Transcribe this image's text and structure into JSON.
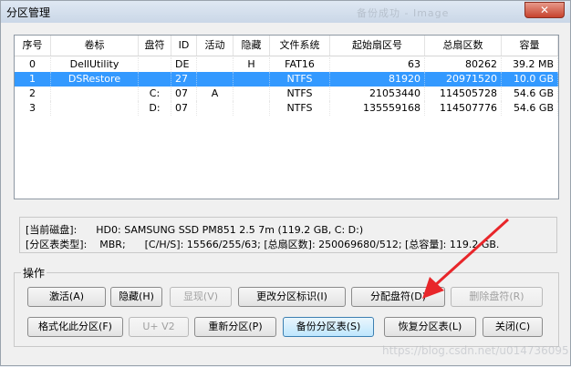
{
  "window": {
    "title": "分区管理",
    "blurred_title_text": "备份成功 - Image",
    "close_glyph": "✕"
  },
  "table": {
    "headers": [
      "序号",
      "卷标",
      "盘符",
      "ID",
      "活动",
      "隐藏",
      "文件系统",
      "起始扇区号",
      "总扇区数",
      "容量"
    ],
    "rows": [
      {
        "idx": "0",
        "label": "DellUtility",
        "drive": "",
        "id": "DE",
        "active": "",
        "hidden": "H",
        "fs": "FAT16",
        "start": "63",
        "total": "80262",
        "size": "39.2 MB",
        "selected": false
      },
      {
        "idx": "1",
        "label": "DSRestore",
        "drive": "",
        "id": "27",
        "active": "",
        "hidden": "",
        "fs": "NTFS",
        "start": "81920",
        "total": "20971520",
        "size": "10.0 GB",
        "selected": true
      },
      {
        "idx": "2",
        "label": "",
        "drive": "C:",
        "id": "07",
        "active": "A",
        "hidden": "",
        "fs": "NTFS",
        "start": "21053440",
        "total": "114505728",
        "size": "54.6 GB",
        "selected": false
      },
      {
        "idx": "3",
        "label": "",
        "drive": "D:",
        "id": "07",
        "active": "",
        "hidden": "",
        "fs": "NTFS",
        "start": "135559168",
        "total": "114507776",
        "size": "54.6 GB",
        "selected": false
      }
    ]
  },
  "info": {
    "line1": "[当前磁盘]:      HD0: SAMSUNG SSD PM851 2.5 7m (119.2 GB, C: D:)",
    "line2": "[分区表类型]:    MBR;      [C/H/S]: 15566/255/63; [总扇区数]: 250069680/512; [总容量]: 119.2 GB."
  },
  "ops": {
    "group_label": "操作",
    "activate": "激活(A)",
    "hide": "隐藏(H)",
    "show": "显现(V)",
    "change_id": "更改分区标识(I)",
    "assign_letter": "分配盘符(D)",
    "remove_letter": "删除盘符(R)",
    "format": "格式化此分区(F)",
    "u_v2": "U+ V2",
    "repartition": "重新分区(P)",
    "backup_table": "备份分区表(S)",
    "restore_table": "恢复分区表(L)",
    "close": "关闭(C)"
  },
  "watermark": "https://blog.csdn.net/u014736095",
  "colors": {
    "selection": "#3399ff",
    "arrow": "#e8262a"
  }
}
